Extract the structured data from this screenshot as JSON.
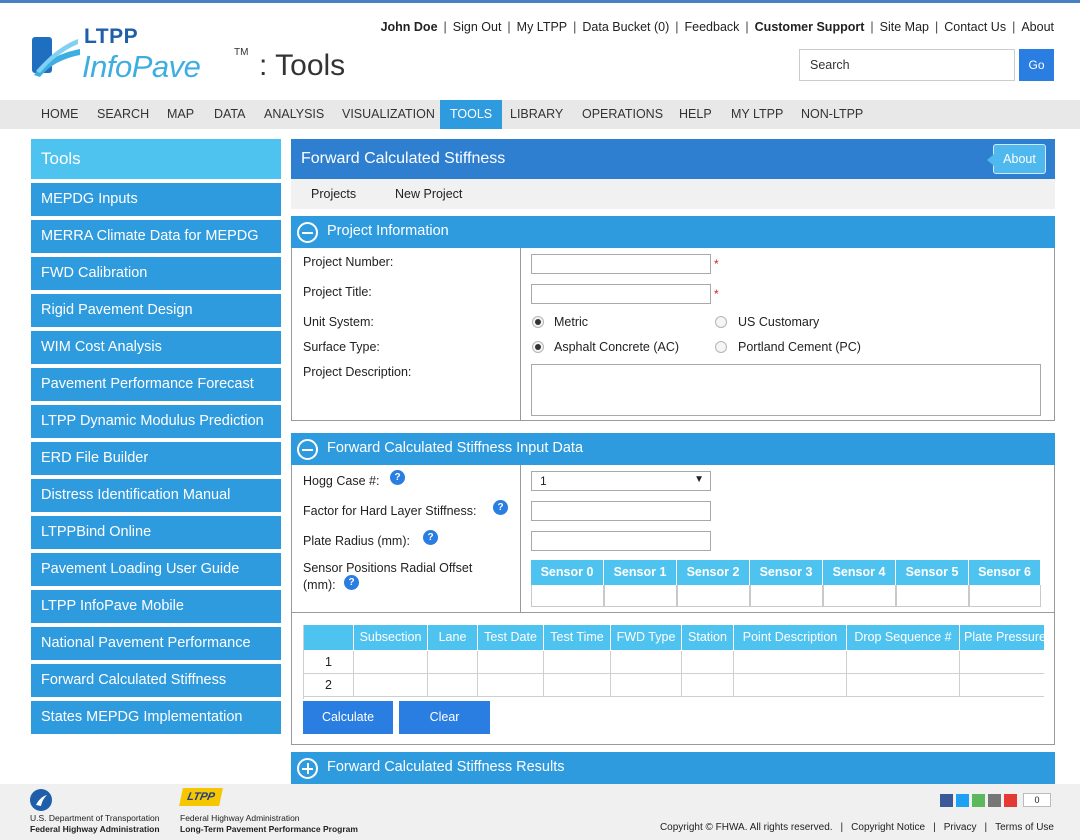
{
  "header": {
    "logo_ltpp": "LTPP",
    "logo_infopave": "InfoPave",
    "logo_tm": "TM",
    "logo_tools": ": Tools",
    "user": "John Doe",
    "links": [
      "Sign Out",
      "My LTPP",
      "Data Bucket (0)",
      "Feedback",
      "Customer Support",
      "Site Map",
      "Contact Us",
      "About"
    ],
    "search_placeholder": "Search",
    "search_button": "Go"
  },
  "nav": {
    "items": [
      "HOME",
      "SEARCH",
      "MAP",
      "DATA",
      "ANALYSIS",
      "VISUALIZATION",
      "TOOLS",
      "LIBRARY",
      "OPERATIONS",
      "HELP",
      "MY LTPP",
      "NON-LTPP"
    ],
    "active": "TOOLS"
  },
  "sidebar": {
    "title": "Tools",
    "items": [
      "MEPDG Inputs",
      "MERRA Climate Data for MEPDG",
      "FWD Calibration",
      "Rigid Pavement Design",
      "WIM Cost Analysis",
      "Pavement Performance Forecast",
      "LTPP Dynamic Modulus Prediction",
      "ERD File Builder",
      "Distress Identification Manual",
      "LTPPBind Online",
      "Pavement Loading User Guide",
      "LTPP InfoPave Mobile",
      "National Pavement Performance",
      "Forward Calculated Stiffness",
      "States MEPDG Implementation"
    ]
  },
  "main": {
    "title": "Forward Calculated Stiffness",
    "about": "About",
    "tabs": [
      "Projects",
      "New Project"
    ]
  },
  "project_info": {
    "title": "Project Information",
    "number_label": "Project Number:",
    "title_label": "Project Title:",
    "unit_label": "Unit System:",
    "unit_options": [
      "Metric",
      "US Customary"
    ],
    "unit_selected": "Metric",
    "surface_label": "Surface Type:",
    "surface_options": [
      "Asphalt Concrete (AC)",
      "Portland Cement (PC)"
    ],
    "surface_selected": "Asphalt Concrete (AC)",
    "description_label": "Project Description:",
    "required_mark": "*"
  },
  "input_data": {
    "title": "Forward Calculated Stiffness Input Data",
    "hogg_label": "Hogg Case #:",
    "hogg_value": "1",
    "factor_label": "Factor for Hard Layer Stiffness:",
    "plate_label": "Plate Radius (mm):",
    "sensor_label_1": "Sensor Positions Radial Offset",
    "sensor_label_2": "(mm):",
    "help_glyph": "?",
    "sensors": [
      "Sensor 0",
      "Sensor 1",
      "Sensor 2",
      "Sensor 3",
      "Sensor 4",
      "Sensor 5",
      "Sensor 6"
    ],
    "grid_columns": [
      "",
      "Subsection",
      "Lane",
      "Test Date",
      "Test Time",
      "FWD Type",
      "Station",
      "Point Description",
      "Drop Sequence #",
      "Plate Pressure"
    ],
    "grid_rows": [
      "1",
      "2"
    ],
    "calculate": "Calculate",
    "clear": "Clear"
  },
  "results": {
    "title": "Forward Calculated Stiffness Results"
  },
  "footer": {
    "dot_line1": "U.S. Department of Transportation",
    "dot_line2": "Federal Highway Administration",
    "ltpp_badge": "LTPP",
    "fhwa_line1": "Federal Highway Administration",
    "fhwa_line2": "Long-Term Pavement Performance Program",
    "share_count": "0",
    "copyright": "Copyright © FHWA. All rights reserved.",
    "links": [
      "Copyright Notice",
      "Privacy",
      "Terms of Use"
    ]
  },
  "colors": {
    "accent": "#2f9bdf",
    "title_bar": "#2f7fd0",
    "button": "#2a7de1",
    "light_accent": "#4fc3f0",
    "required": "#d42020"
  }
}
